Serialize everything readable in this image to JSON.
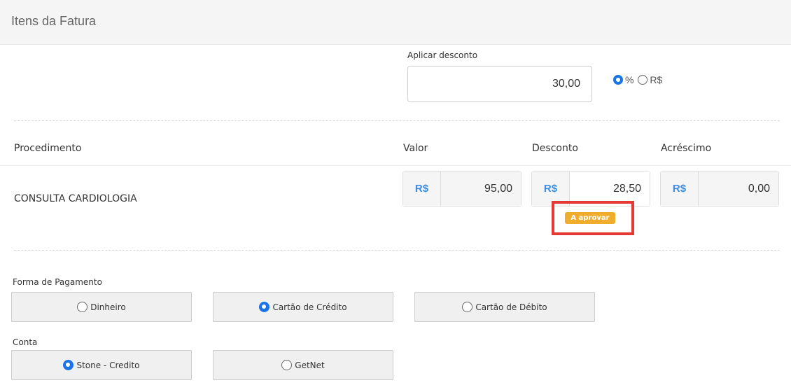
{
  "header": {
    "title": "Itens da Fatura"
  },
  "discount": {
    "label": "Aplicar desconto",
    "value": "30,00",
    "type_options": [
      {
        "label": "%",
        "checked": true
      },
      {
        "label": "R$",
        "checked": false
      }
    ]
  },
  "table": {
    "headers": {
      "procedure": "Procedimento",
      "value": "Valor",
      "discount": "Desconto",
      "surcharge": "Acréscimo"
    },
    "row": {
      "procedure": "CONSULTA CARDIOLOGIA",
      "currency": "R$",
      "value": "95,00",
      "discount": "28,50",
      "surcharge": "0,00",
      "status_badge": "A aprovar"
    }
  },
  "payment": {
    "label": "Forma de Pagamento",
    "options": [
      {
        "label": "Dinheiro",
        "checked": false
      },
      {
        "label": "Cartão de Crédito",
        "checked": true
      },
      {
        "label": "Cartão de Débito",
        "checked": false
      }
    ]
  },
  "account": {
    "label": "Conta",
    "options": [
      {
        "label": "Stone - Credito",
        "checked": true
      },
      {
        "label": "GetNet",
        "checked": false
      }
    ]
  },
  "colors": {
    "accent": "#1a73e8",
    "badge": "#f0ad2c",
    "highlight": "#e53935",
    "currency": "#3a8ee6"
  }
}
